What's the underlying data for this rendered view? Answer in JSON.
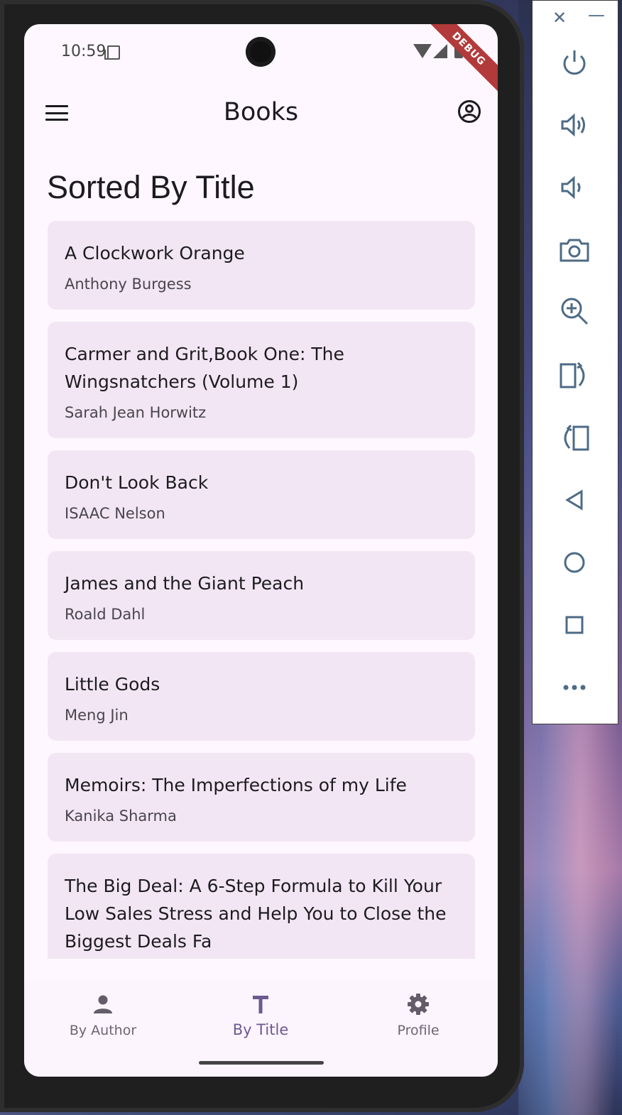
{
  "status_bar": {
    "time": "10:59",
    "debug_label": "DEBUG"
  },
  "app_bar": {
    "title": "Books"
  },
  "section": {
    "title": "Sorted By Title"
  },
  "books": [
    {
      "title": "A Clockwork Orange",
      "author": "Anthony Burgess"
    },
    {
      "title": "Carmer and Grit,Book One: The Wingsnatchers (Volume 1)",
      "author": "Sarah Jean Horwitz"
    },
    {
      "title": "Don't Look Back",
      "author": "ISAAC Nelson"
    },
    {
      "title": "James and the Giant Peach",
      "author": "Roald Dahl"
    },
    {
      "title": "Little Gods",
      "author": "Meng Jin"
    },
    {
      "title": "Memoirs: The Imperfections of my Life",
      "author": "Kanika Sharma"
    },
    {
      "title": "The Big Deal: A 6-Step Formula to Kill Your Low Sales Stress and Help You to Close the Biggest Deals Fa",
      "author": ""
    }
  ],
  "bottom_nav": {
    "items": [
      {
        "label": "By Author",
        "icon": "person-icon",
        "active": false
      },
      {
        "label": "By Title",
        "icon": "text-t-icon",
        "active": true
      },
      {
        "label": "Profile",
        "icon": "gear-icon",
        "active": false
      }
    ]
  },
  "emulator_panel": {
    "close": "✕",
    "minimize": "—",
    "buttons": [
      "power-icon",
      "volume-up-icon",
      "volume-down-icon",
      "camera-icon",
      "zoom-icon",
      "rotate-right-icon",
      "rotate-left-icon",
      "back-icon",
      "home-icon",
      "overview-icon",
      "more-icon"
    ]
  },
  "colors": {
    "background": "#fef7ff",
    "card": "#f2e6f4",
    "accent": "#6b5a92",
    "debug": "#b23a3a"
  }
}
